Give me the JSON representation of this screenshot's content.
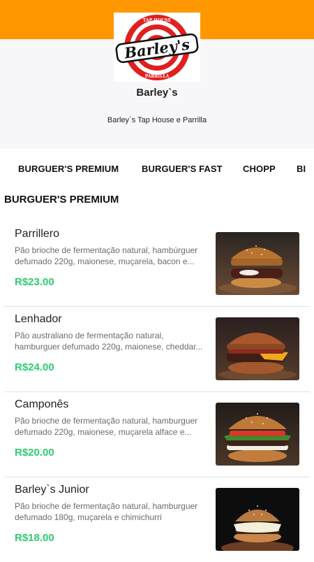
{
  "store": {
    "name": "Barley`s",
    "description": "Barley`s Tap House e Parrilla",
    "logo_text": "Barley's",
    "logo_top_text": "TAP HOUSE",
    "logo_bottom_text": "PARRILLA"
  },
  "colors": {
    "accent": "#ff9800",
    "price": "#2ecc71",
    "logo_red": "#e0201f"
  },
  "categories": [
    {
      "label": "BURGUER'S PREMIUM"
    },
    {
      "label": "BURGUER'S FAST"
    },
    {
      "label": "CHOPP"
    },
    {
      "label": "BI"
    }
  ],
  "section": {
    "title": "BURGUER'S PREMIUM"
  },
  "items": [
    {
      "name": "Parrillero",
      "description": "Pão brioche de fermentação natural, hambúrguer defumado 220g, maionese, muçarela, bacon e...",
      "price": "R$23.00",
      "image": "burger-photo"
    },
    {
      "name": "Lenhador",
      "description": "Pão australiano de fermentação natural, hamburguer defumado 220g, maionese, cheddar...",
      "price": "R$24.00",
      "image": "burger-photo"
    },
    {
      "name": "Camponês",
      "description": "Pão brioche de fermentação natural, hamburguer defumado 220g, maionese, muçarela alface e...",
      "price": "R$20.00",
      "image": "burger-photo"
    },
    {
      "name": "Barley`s Junior",
      "description": "Pão brioche de fermentação natural, hamburguer defumado 180g, muçarela e chimichurri",
      "price": "R$18.00",
      "image": "burger-photo"
    }
  ]
}
